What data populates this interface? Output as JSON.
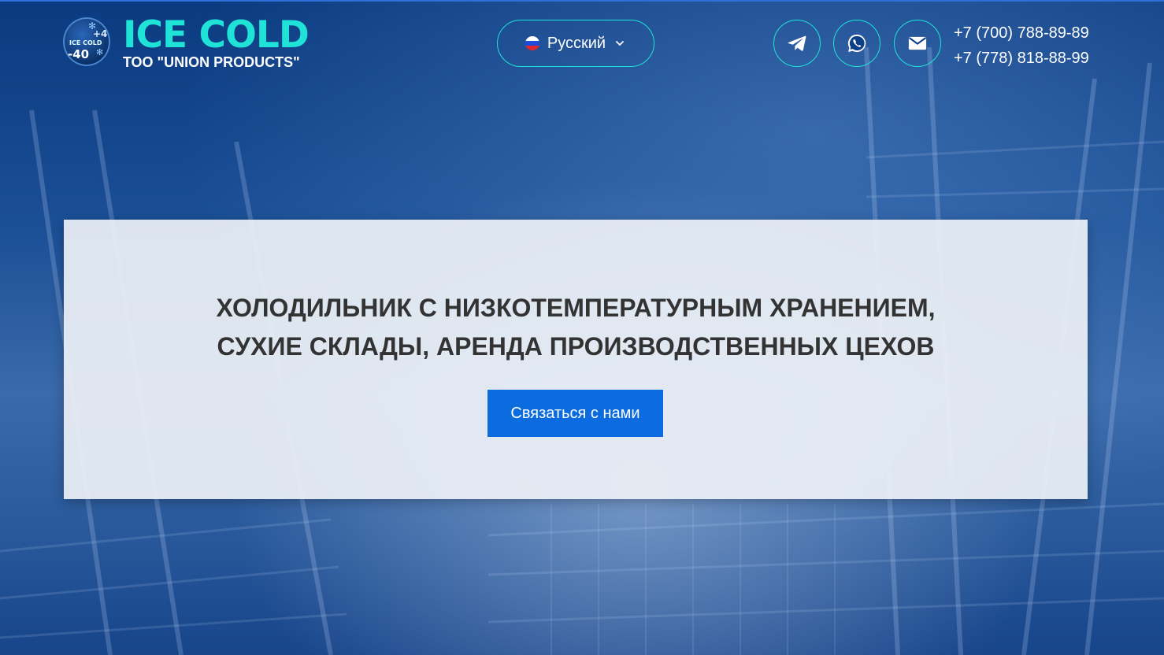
{
  "brand": {
    "badge_top": "+4",
    "badge_mid": "ICE COLD",
    "badge_bottom": "-40",
    "title": "ICE COLD",
    "subtitle": "ТОО \"UNION PRODUCTS\""
  },
  "language": {
    "label": "Русский",
    "flag": "ru-flag-icon"
  },
  "social": {
    "telegram_icon": "telegram-icon",
    "whatsapp_icon": "whatsapp-icon",
    "email_icon": "mail-icon"
  },
  "phones": [
    "+7 (700) 788-89-89",
    "+7 (778) 818-88-99"
  ],
  "hero": {
    "line1": "ХОЛОДИЛЬНИК С НИЗКОТЕМПЕРАТУРНЫМ ХРАНЕНИЕМ,",
    "line2": "СУХИЕ СКЛАДЫ, АРЕНДА ПРОИЗВОДСТВЕННЫХ ЦЕХОВ",
    "cta_label": "Связаться с нами"
  },
  "colors": {
    "accent": "#1ee3d6",
    "button": "#0c6cdf",
    "background": "#0d3f86",
    "heading": "#333333"
  }
}
